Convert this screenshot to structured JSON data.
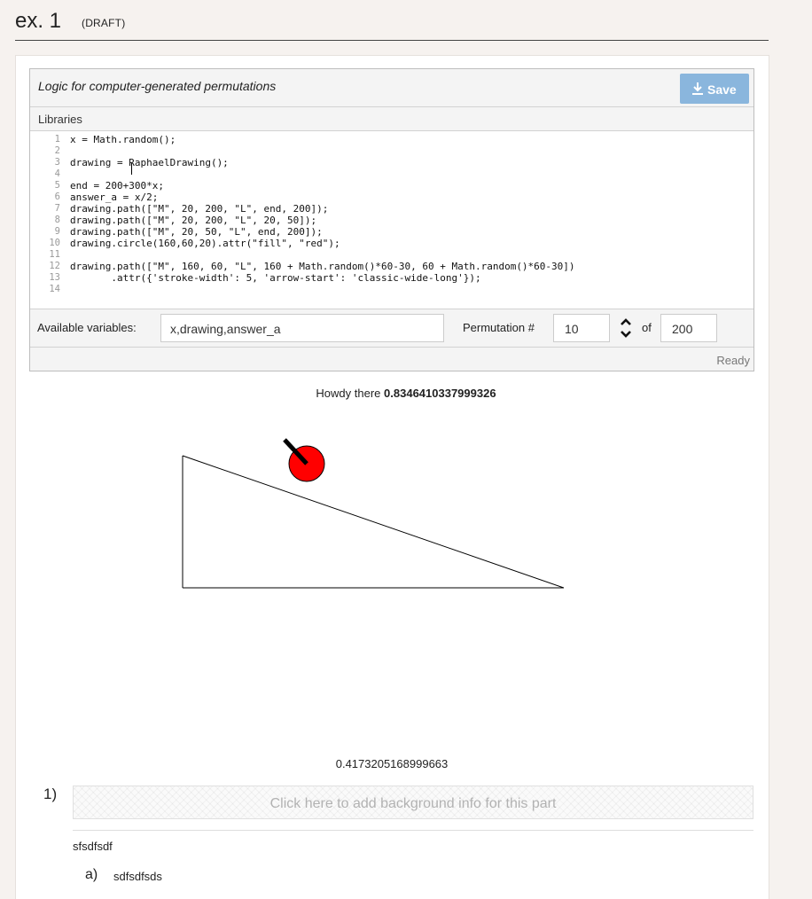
{
  "header": {
    "title": "ex. 1",
    "draft_label": "(DRAFT)"
  },
  "editor": {
    "title": "Logic for computer-generated permutations",
    "save_label": "Save",
    "libraries_label": "Libraries",
    "code_lines": [
      {
        "n": "1",
        "text": "x = Math.random();"
      },
      {
        "n": "2",
        "text": ""
      },
      {
        "n": "3",
        "text": "drawing = RaphaelDrawing();"
      },
      {
        "n": "4",
        "text": ""
      },
      {
        "n": "5",
        "text": "end = 200+300*x;"
      },
      {
        "n": "6",
        "text": "answer_a = x/2;"
      },
      {
        "n": "7",
        "text": "drawing.path([\"M\", 20, 200, \"L\", end, 200]);"
      },
      {
        "n": "8",
        "text": "drawing.path([\"M\", 20, 200, \"L\", 20, 50]);"
      },
      {
        "n": "9",
        "text": "drawing.path([\"M\", 20, 50, \"L\", end, 200]);"
      },
      {
        "n": "10",
        "text": "drawing.circle(160,60,20).attr(\"fill\", \"red\");"
      },
      {
        "n": "11",
        "text": ""
      },
      {
        "n": "12",
        "text": "drawing.path([\"M\", 160, 60, \"L\", 160 + Math.random()*60-30, 60 + Math.random()*60-30])"
      },
      {
        "n": "13",
        "text": "       .attr({'stroke-width': 5, 'arrow-start': 'classic-wide-long'});"
      },
      {
        "n": "14",
        "text": ""
      }
    ],
    "available_variables_label": "Available variables:",
    "available_variables_value": "x,drawing,answer_a",
    "permutation_label": "Permutation #",
    "permutation_value": "10",
    "of_label": "of",
    "of_value": "200",
    "status": "Ready"
  },
  "output": {
    "howdy_prefix": "Howdy there",
    "howdy_value": "0.8346410337999326",
    "drawing": {
      "circle_fill": "#ff0000",
      "stroke": "#000000"
    },
    "second_value": "0.4173205168999663"
  },
  "part": {
    "number": "1)",
    "background_placeholder": "Click here to add background info for this part",
    "text": "sfsdfsdf",
    "subparts": [
      {
        "letter": "a)",
        "text": "sdfsdfsds"
      }
    ]
  },
  "colors": {
    "save_button": "#8ab6dd",
    "page_bg": "#f6f2ef"
  }
}
